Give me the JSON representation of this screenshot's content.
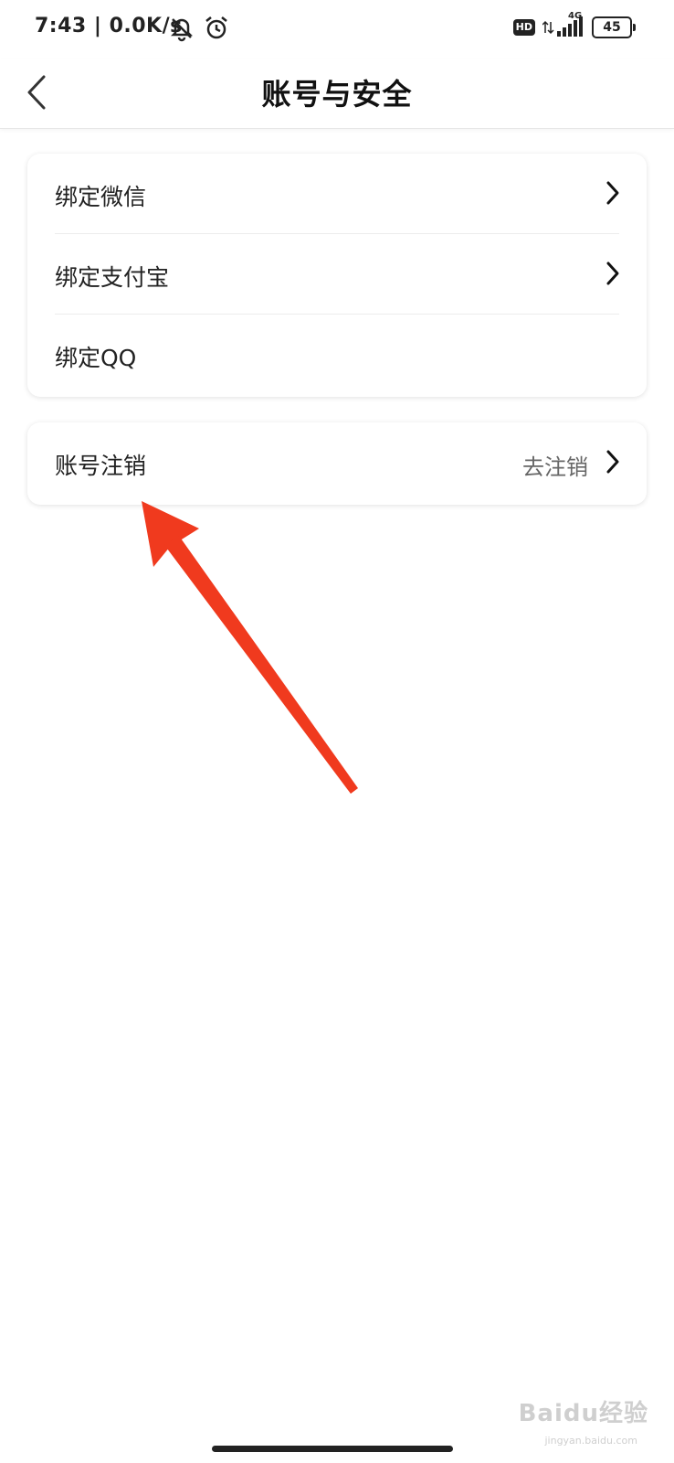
{
  "status_bar": {
    "time": "7:43 | 0.0K/s",
    "icons": [
      "bell-muted-icon",
      "alarm-icon"
    ],
    "hd": "HD",
    "network": "4G",
    "battery": "45"
  },
  "nav": {
    "title": "账号与安全",
    "back_icon": "chevron-left-icon"
  },
  "bind_section": {
    "items": [
      {
        "label": "绑定微信"
      },
      {
        "label": "绑定支付宝"
      },
      {
        "label": "绑定QQ"
      }
    ]
  },
  "account_section": {
    "label": "账号注销",
    "value": "去注销"
  },
  "colors": {
    "annotation_arrow": "#f03a1e",
    "text_primary": "#222222",
    "text_secondary": "#666666"
  },
  "watermark": {
    "brand": "Baidu经验",
    "url": "jingyan.baidu.com"
  }
}
